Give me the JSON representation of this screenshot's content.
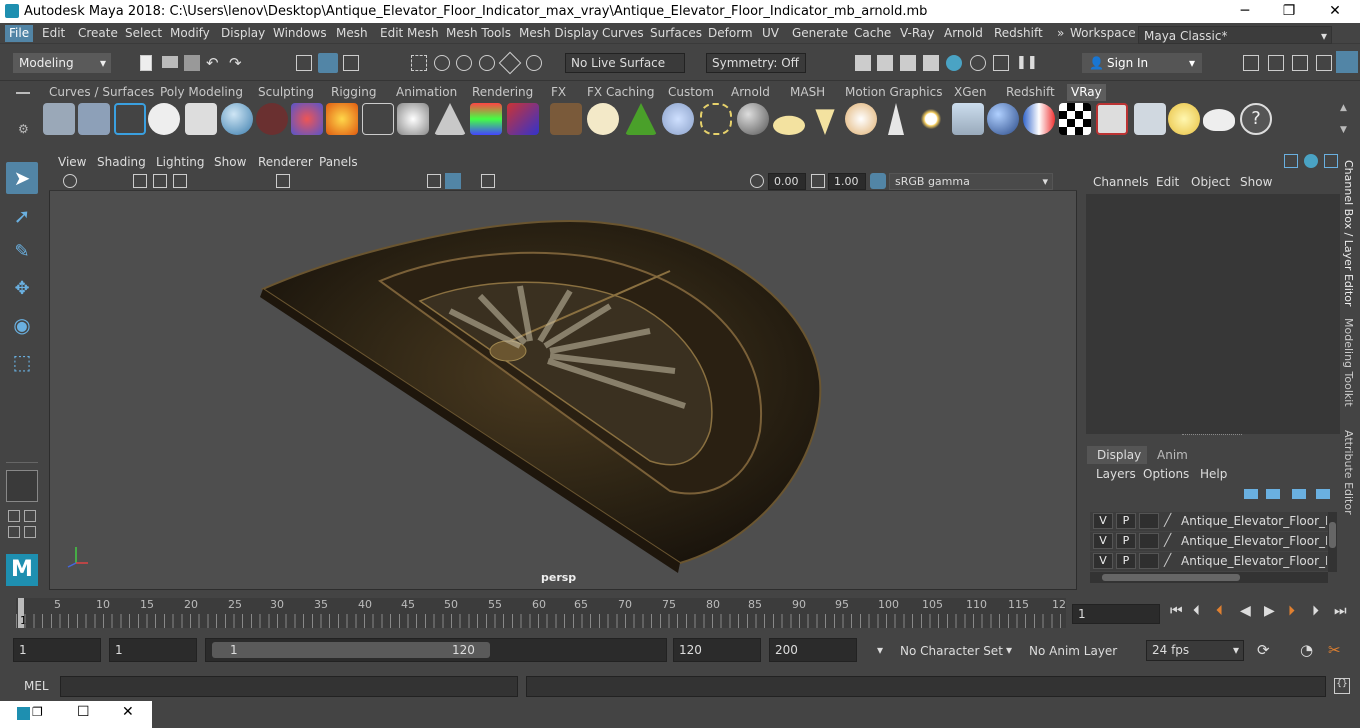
{
  "window": {
    "title": "Autodesk Maya 2018: C:\\Users\\lenov\\Desktop\\Antique_Elevator_Floor_Indicator_max_vray\\Antique_Elevator_Floor_Indicator_mb_arnold.mb",
    "min_glyph": "─",
    "max_glyph": "❐",
    "close_glyph": "✕"
  },
  "menu": {
    "items": [
      "File",
      "Edit",
      "Create",
      "Select",
      "Modify",
      "Display",
      "Windows",
      "Mesh",
      "Edit Mesh",
      "Mesh Tools",
      "Mesh Display",
      "Curves",
      "Surfaces",
      "Deform",
      "UV",
      "Generate",
      "Cache",
      "V-Ray",
      "Arnold",
      "Redshift"
    ],
    "workspace_label": "Workspace :",
    "workspace_value": "Maya Classic*"
  },
  "status": {
    "mode": "Modeling",
    "live_surface": "No Live Surface",
    "symmetry": "Symmetry: Off",
    "sign_in": "Sign In"
  },
  "shelf": {
    "tabs": [
      "Curves / Surfaces",
      "Poly Modeling",
      "Sculpting",
      "Rigging",
      "Animation",
      "Rendering",
      "FX",
      "FX Caching",
      "Custom",
      "Arnold",
      "MASH",
      "Motion Graphics",
      "XGen",
      "Redshift",
      "VRay"
    ],
    "active_tab": "VRay"
  },
  "viewport": {
    "menus": [
      "View",
      "Shading",
      "Lighting",
      "Show",
      "Renderer",
      "Panels"
    ],
    "exposure": "0.00",
    "gamma": "1.00",
    "color_space": "sRGB gamma",
    "camera_label": "persp"
  },
  "channel_box": {
    "menus": [
      "Channels",
      "Edit",
      "Object",
      "Show"
    ],
    "vertical_tabs": [
      "Channel Box / Layer Editor",
      "Modeling Toolkit",
      "Attribute Editor"
    ]
  },
  "layer_editor": {
    "tabs": [
      "Display",
      "Anim"
    ],
    "menus": [
      "Layers",
      "Options",
      "Help"
    ],
    "layers": [
      {
        "v": "V",
        "p": "P",
        "name": "Antique_Elevator_Floor_Indi"
      },
      {
        "v": "V",
        "p": "P",
        "name": "Antique_Elevator_Floor_Indi"
      },
      {
        "v": "V",
        "p": "P",
        "name": "Antique_Elevator_Floor_Indi"
      }
    ]
  },
  "timeline": {
    "ticks": [
      "5",
      "10",
      "15",
      "20",
      "25",
      "30",
      "35",
      "40",
      "45",
      "50",
      "55",
      "60",
      "65",
      "70",
      "75",
      "80",
      "85",
      "90",
      "95",
      "100",
      "105",
      "110",
      "115",
      "12"
    ],
    "first": "1",
    "current_frame": "1"
  },
  "range": {
    "start": "1",
    "playback_start": "1",
    "slider_start": "1",
    "slider_end": "120",
    "playback_end": "120",
    "end": "200",
    "character_set": "No Character Set",
    "anim_layer": "No Anim Layer",
    "fps": "24 fps"
  },
  "command": {
    "label": "MEL"
  }
}
